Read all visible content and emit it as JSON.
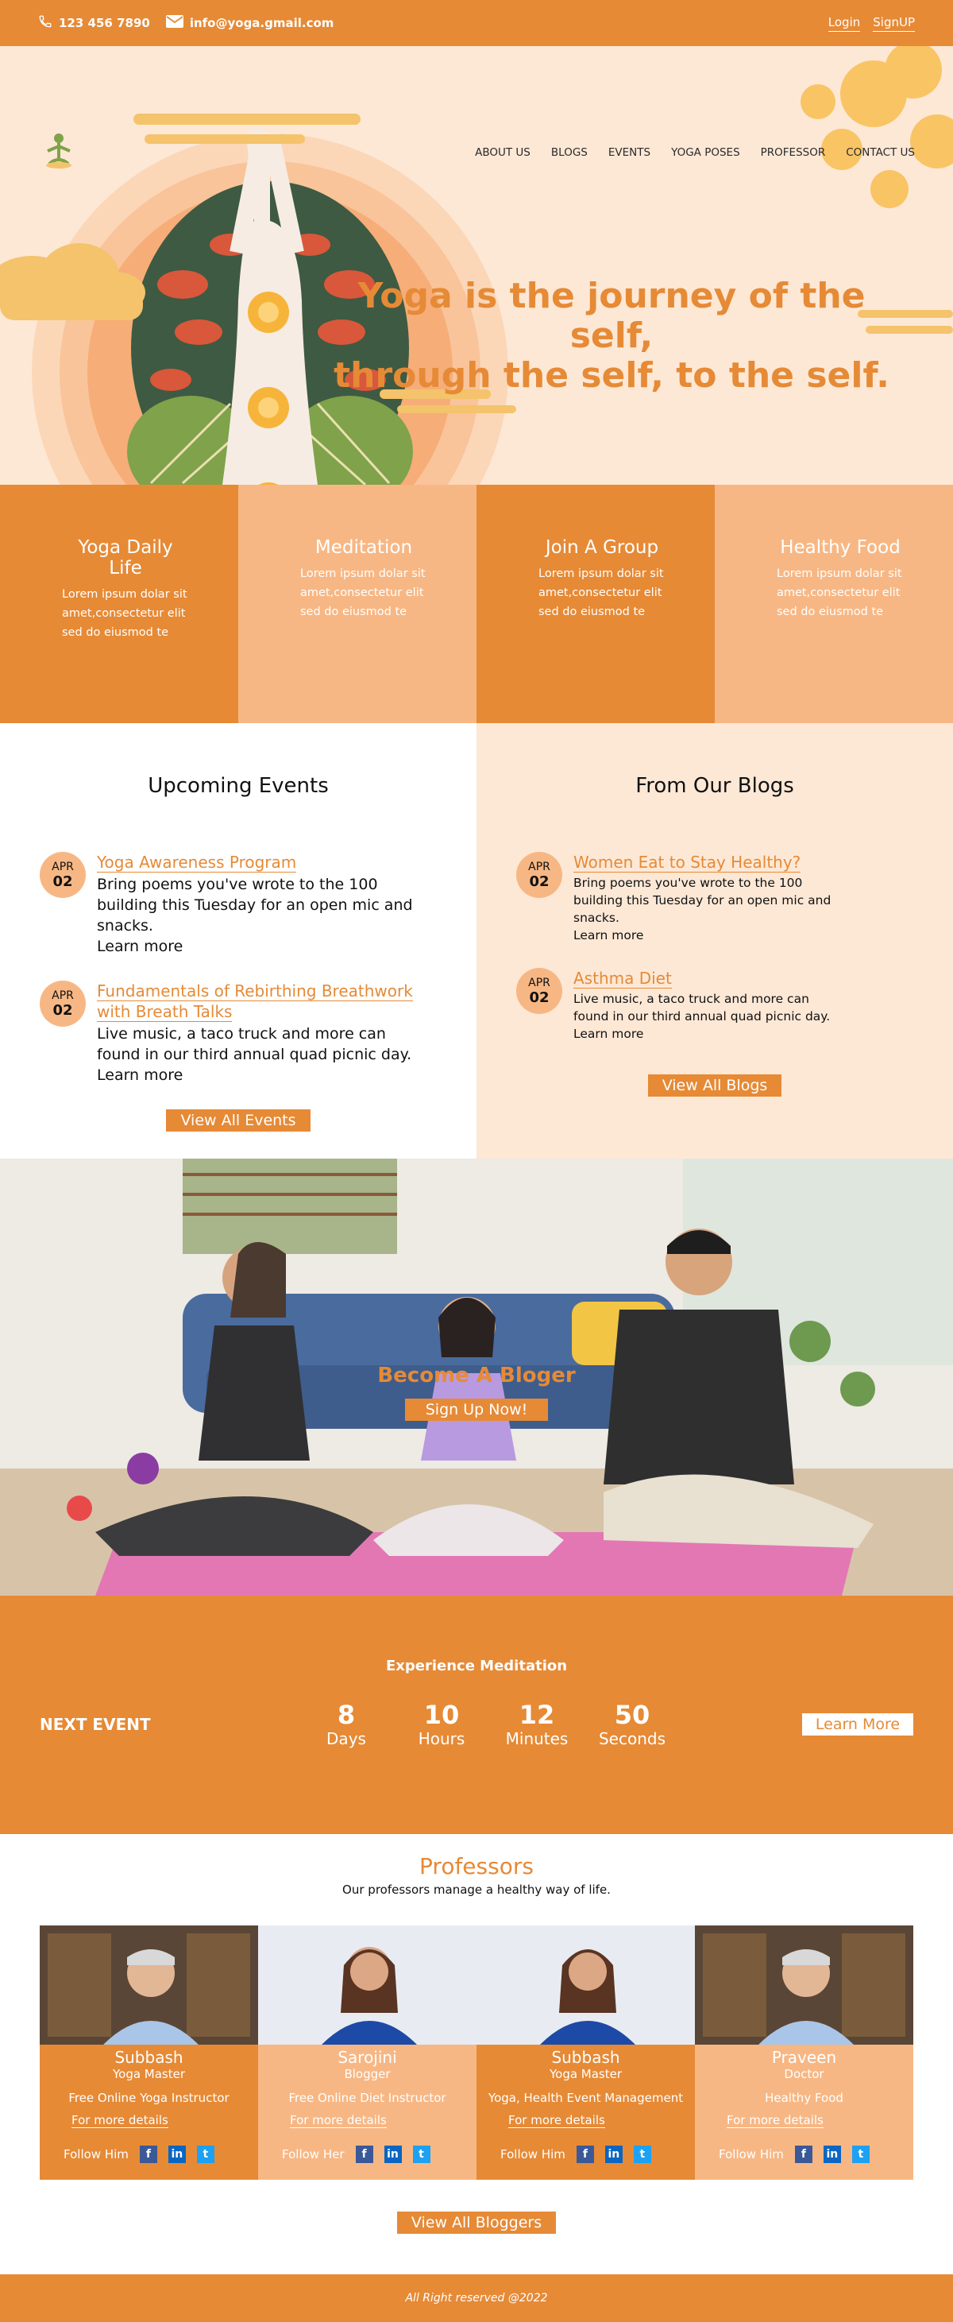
{
  "topbar": {
    "phone": "123 456 7890",
    "email": "info@yoga.gmail.com",
    "login": "Login",
    "signup": "SignUP"
  },
  "nav": [
    "ABOUT US",
    "BLOGS",
    "EVENTS",
    "YOGA POSES",
    "PROFESSOR",
    "CONTACT US"
  ],
  "hero": {
    "quote_line1": "Yoga is the journey of the self,",
    "quote_line2": "through the self, to the self."
  },
  "features": [
    {
      "title": "Yoga Daily Life",
      "text": "Lorem ipsum dolar sit amet,consectetur  elit sed do eiusmod te"
    },
    {
      "title": "Meditation",
      "text": "Lorem ipsum dolar sit amet,consectetur  elit sed do eiusmod te"
    },
    {
      "title": "Join A Group",
      "text": "Lorem ipsum dolar sit amet,consectetur  elit sed do eiusmod te"
    },
    {
      "title": "Healthy Food",
      "text": "Lorem ipsum dolar sit amet,consectetur  elit sed do eiusmod te"
    }
  ],
  "events": {
    "heading": "Upcoming Events",
    "items": [
      {
        "month": "APR",
        "day": "02",
        "title": "Yoga Awareness Program",
        "desc": "Bring poems you've wrote to the 100 building this Tuesday for an open mic and snacks.",
        "more": "Learn more"
      },
      {
        "month": "APR",
        "day": "02",
        "title": "Fundamentals of Rebirthing Breathwork with Breath Talks",
        "desc": "Live music, a taco truck and more can found in our third annual quad picnic day.",
        "more": "Learn more"
      }
    ],
    "button": "View All Events"
  },
  "blogs": {
    "heading": "From Our Blogs",
    "items": [
      {
        "month": "APR",
        "day": "02",
        "title": "Women Eat to Stay Healthy?",
        "desc": "Bring poems you've wrote to the 100 building this Tuesday for an open mic and snacks.",
        "more": "Learn more"
      },
      {
        "month": "APR",
        "day": "02",
        "title": "Asthma Diet",
        "desc": "Live music, a taco truck and more can found in our third annual quad picnic day.",
        "more": "Learn more"
      }
    ],
    "button": "View All Blogs"
  },
  "banner": {
    "title": "Become A Bloger",
    "button": "Sign Up Now!"
  },
  "countdown": {
    "heading": "Experience Meditation",
    "label": "NEXT EVENT",
    "units": [
      {
        "value": "8",
        "label": "Days"
      },
      {
        "value": "10",
        "label": "Hours"
      },
      {
        "value": "12",
        "label": "Minutes"
      },
      {
        "value": "50",
        "label": "Seconds"
      }
    ],
    "button": "Learn More"
  },
  "professors": {
    "heading": "Professors",
    "subheading": "Our professors manage a healthy way of life.",
    "cards": [
      {
        "name": "Subbash",
        "role": "Yoga Master",
        "desc": "Free Online Yoga Instructor",
        "details": "For more details",
        "follow": "Follow Him"
      },
      {
        "name": "Sarojini",
        "role": "Blogger",
        "desc": "Free Online Diet Instructor",
        "details": "For more details",
        "follow": "Follow Her"
      },
      {
        "name": "Subbash",
        "role": "Yoga Master",
        "desc": "Yoga, Health Event Management",
        "details": "For more details",
        "follow": "Follow Him"
      },
      {
        "name": "Praveen",
        "role": "Doctor",
        "desc": "Healthy Food",
        "details": "For more details",
        "follow": "Follow Him"
      }
    ],
    "button": "View All Bloggers"
  },
  "footer": "All Right reserved @2022",
  "colors": {
    "primary": "#e68a36",
    "light": "#f7b784",
    "cream": "#fde8d6"
  }
}
